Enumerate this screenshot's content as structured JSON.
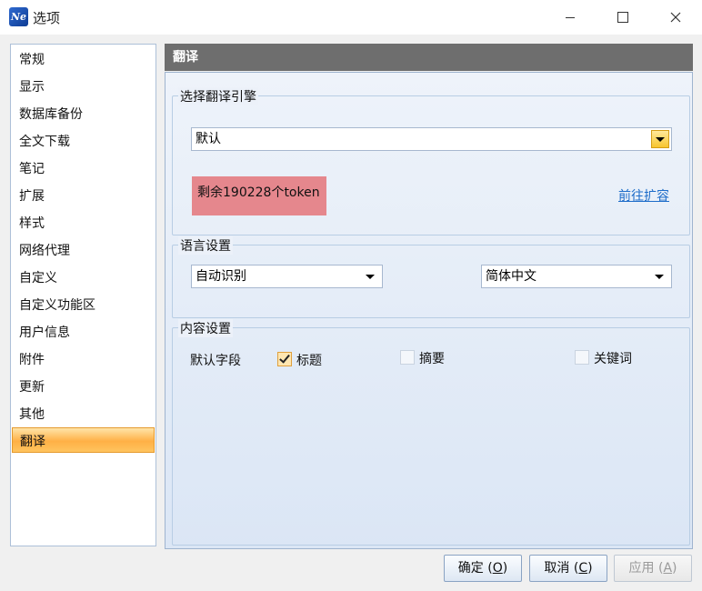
{
  "window": {
    "title": "选项",
    "app_icon_text": "Ne",
    "minimize_icon": "minimize-icon",
    "maximize_icon": "maximize-icon",
    "close_icon": "close-icon"
  },
  "nav": {
    "items": [
      {
        "label": "常规"
      },
      {
        "label": "显示"
      },
      {
        "label": "数据库备份"
      },
      {
        "label": "全文下载"
      },
      {
        "label": "笔记"
      },
      {
        "label": "扩展"
      },
      {
        "label": "样式"
      },
      {
        "label": "网络代理"
      },
      {
        "label": "自定义"
      },
      {
        "label": "自定义功能区"
      },
      {
        "label": "用户信息"
      },
      {
        "label": "附件"
      },
      {
        "label": "更新"
      },
      {
        "label": "其他"
      },
      {
        "label": "翻译"
      }
    ],
    "selected": "翻译"
  },
  "panel": {
    "header": "翻译",
    "engine_group": {
      "title": "选择翻译引擎",
      "engine_value": "默认",
      "token_text": "剩余190228个token",
      "expand_link": "前往扩容"
    },
    "language_group": {
      "title": "语言设置",
      "source_value": "自动识别",
      "target_value": "简体中文"
    },
    "content_group": {
      "title": "内容设置",
      "default_fields_label": "默认字段",
      "fields": [
        {
          "label": "标题",
          "checked": true
        },
        {
          "label": "摘要",
          "checked": false
        },
        {
          "label": "关键词",
          "checked": false
        }
      ]
    }
  },
  "buttons": {
    "ok": "确定 (",
    "ok_key": "O",
    "cancel": "取消 (",
    "cancel_key": "C",
    "apply": "应用 (",
    "apply_key": "A",
    "close_paren": ")"
  },
  "colors": {
    "selected_nav": "#ffb045",
    "header_bg": "#6e6e6e",
    "token_highlight": "#e5878d",
    "link": "#1d6cc9"
  }
}
